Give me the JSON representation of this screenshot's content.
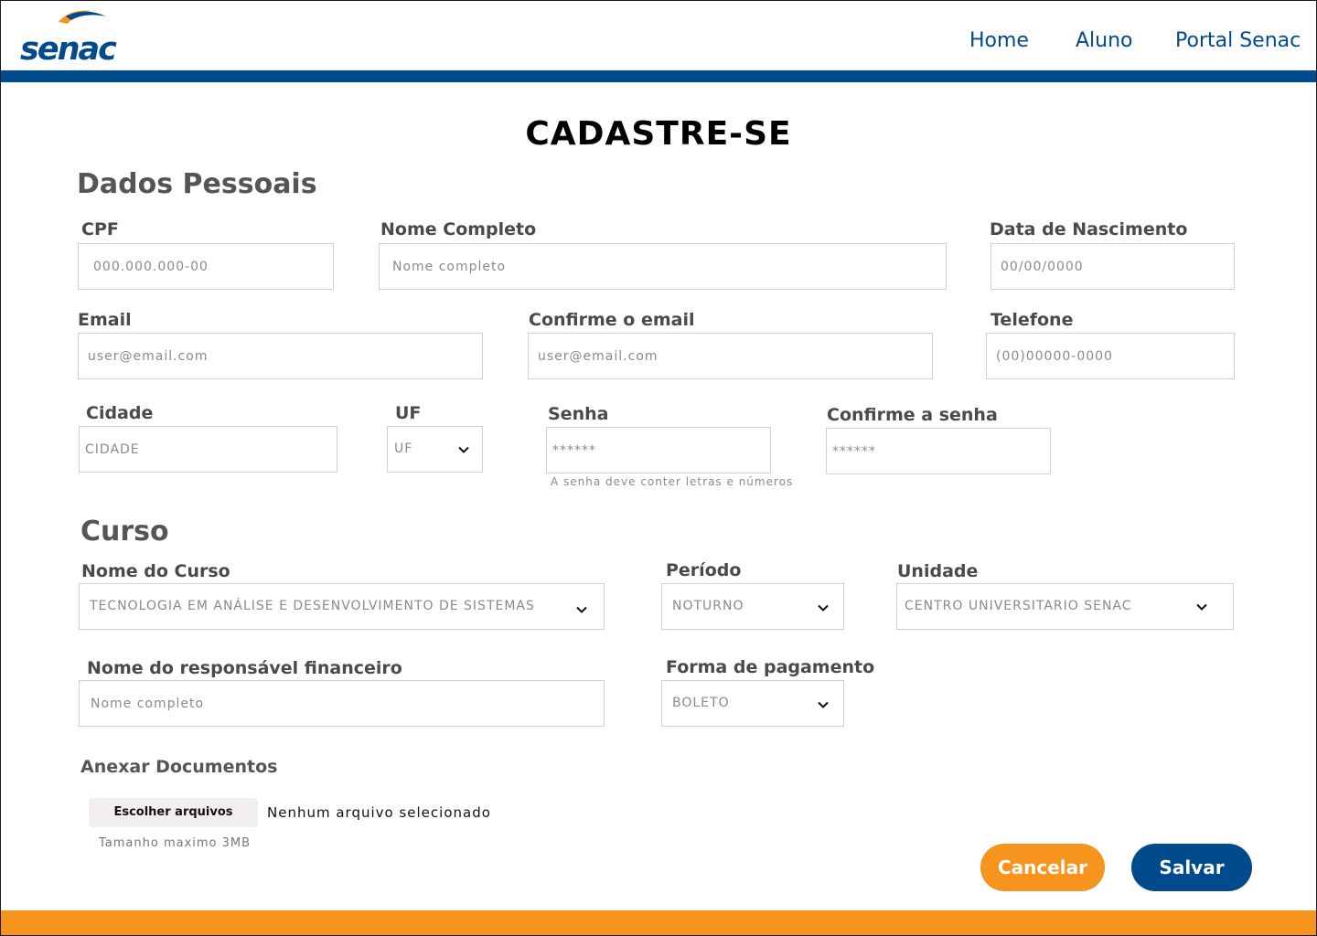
{
  "header": {
    "logo_text": "senac",
    "nav": [
      "Home",
      "Aluno",
      "Portal Senac"
    ]
  },
  "page_title": "CADASTRE-SE",
  "sections": {
    "personal": "Dados Pessoais",
    "course": "Curso"
  },
  "personal": {
    "cpf": {
      "label": "CPF",
      "placeholder": "000.000.000-00"
    },
    "full_name": {
      "label": "Nome Completo",
      "placeholder": "Nome completo"
    },
    "birth_date": {
      "label": "Data de Nascimento",
      "placeholder": "00/00/0000"
    },
    "email": {
      "label": "Email",
      "placeholder": "user@email.com"
    },
    "email_confirm": {
      "label": "Confirme o email",
      "placeholder": "user@email.com"
    },
    "phone": {
      "label": "Telefone",
      "placeholder": "(00)00000-0000"
    },
    "city": {
      "label": "Cidade",
      "placeholder": "CIDADE"
    },
    "uf": {
      "label": "UF",
      "value": "UF"
    },
    "password": {
      "label": "Senha",
      "placeholder": "******",
      "hint": "A senha deve conter letras e números"
    },
    "password_confirm": {
      "label": "Confirme a senha",
      "placeholder": "******"
    }
  },
  "course": {
    "name": {
      "label": "Nome do Curso",
      "value": "TECNOLOGIA EM ANÁLISE E DESENVOLVIMENTO DE SISTEMAS"
    },
    "period": {
      "label": "Período",
      "value": "NOTURNO"
    },
    "unit": {
      "label": "Unidade",
      "value": "CENTRO UNIVERSITARIO SENAC"
    },
    "responsible": {
      "label": "Nome do responsável financeiro",
      "placeholder": "Nome completo"
    },
    "payment": {
      "label": "Forma de pagamento",
      "value": "BOLETO"
    }
  },
  "attachments": {
    "label": "Anexar Documentos",
    "button": "Escolher arquivos",
    "status": "Nenhum arquivo selecionado",
    "hint": "Tamanho maximo 3MB"
  },
  "actions": {
    "cancel": "Cancelar",
    "save": "Salvar"
  },
  "colors": {
    "brand_blue": "#004a8d",
    "brand_orange": "#f7941d",
    "label_gray": "#4a4a4a"
  },
  "icons": [
    "senac-logo",
    "chevron-down-icon"
  ]
}
